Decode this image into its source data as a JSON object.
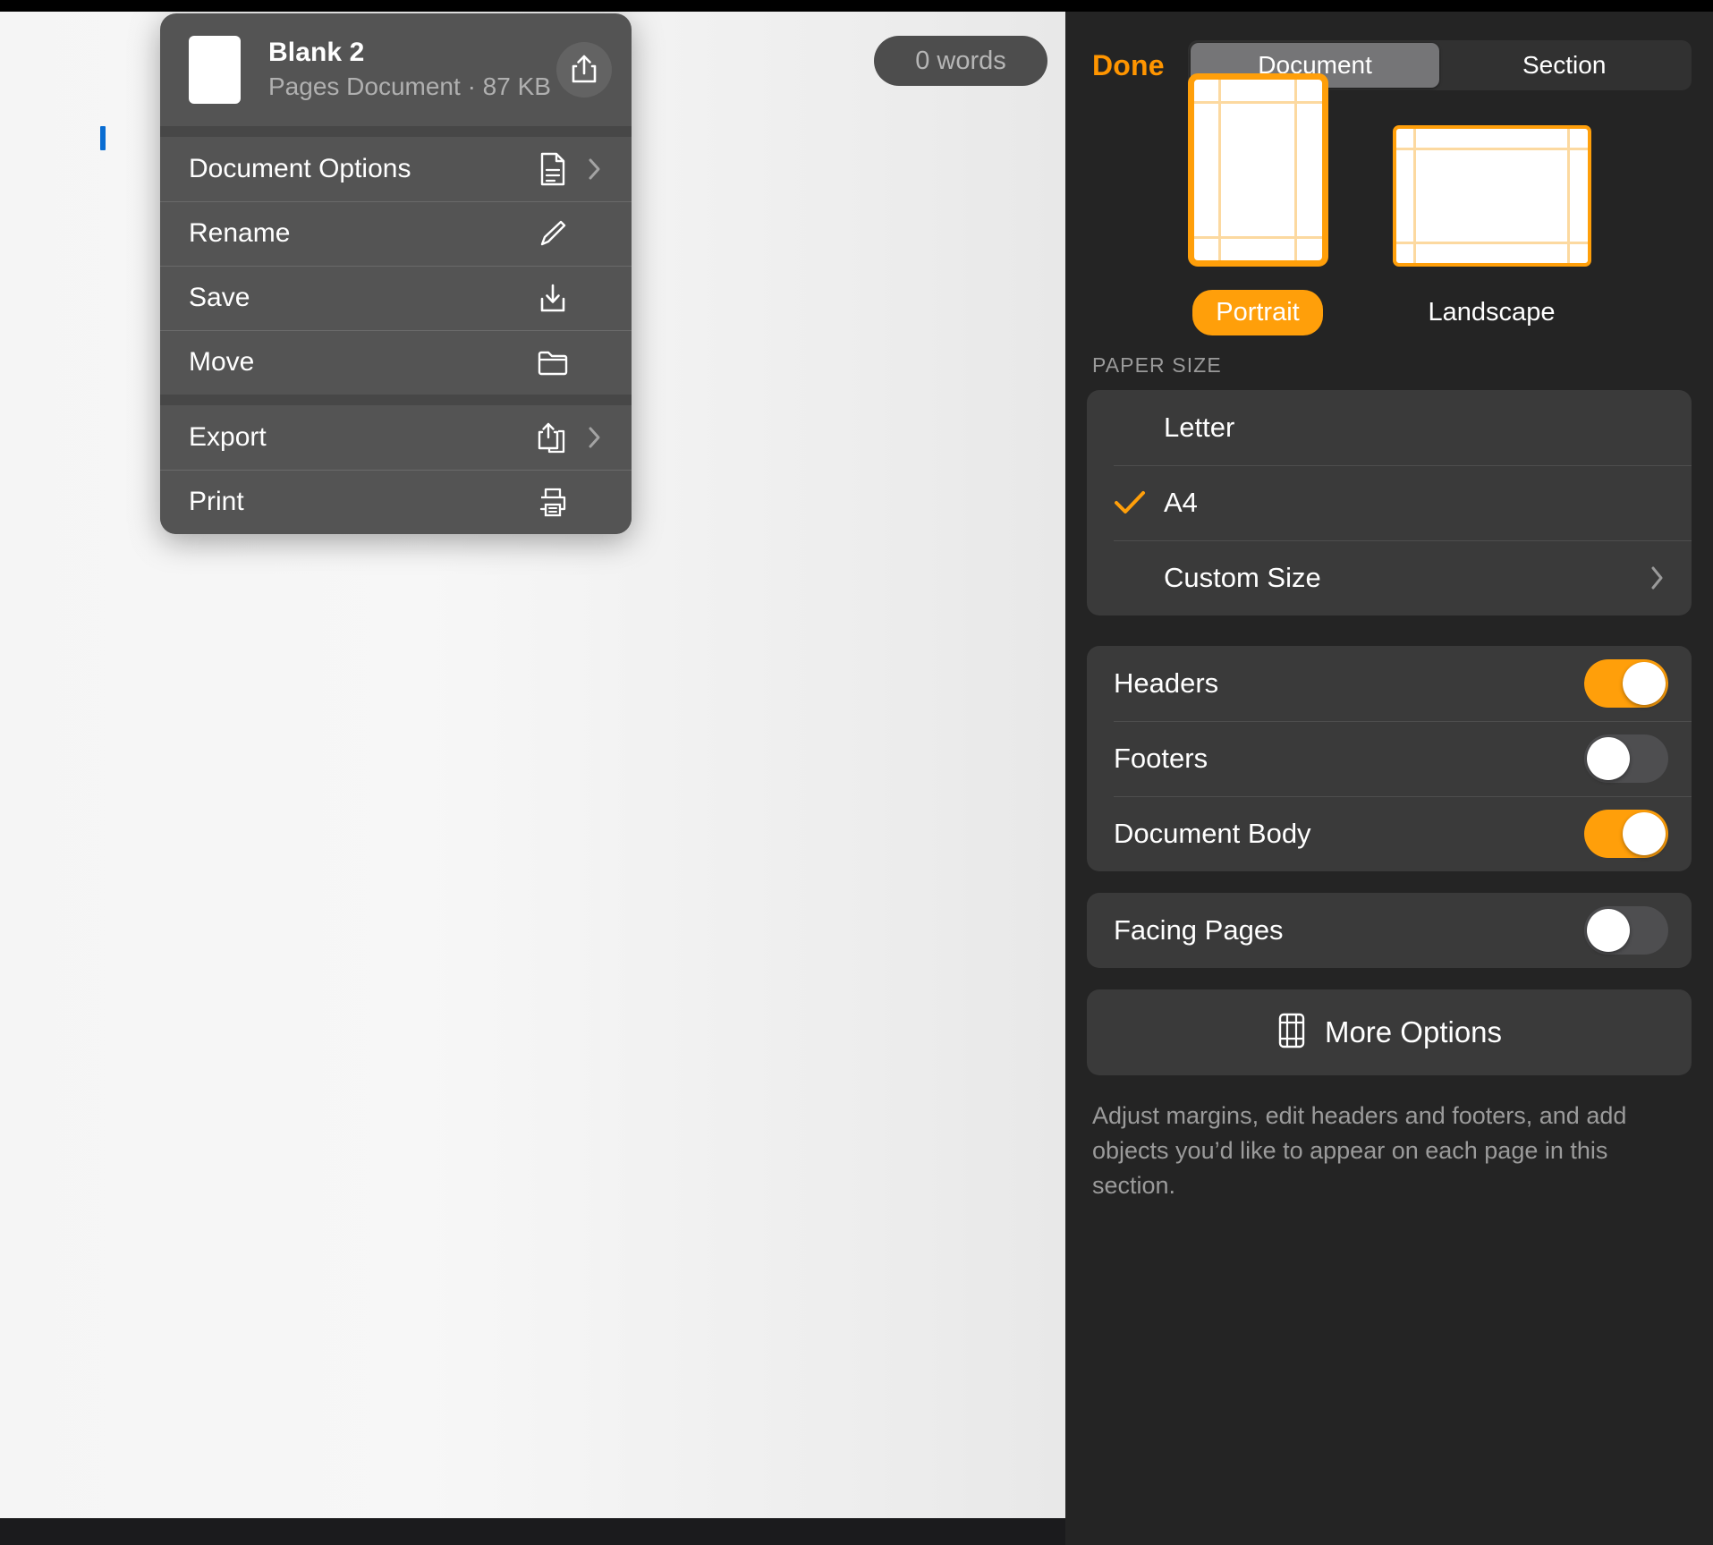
{
  "colors": {
    "accent": "#ff9f0a",
    "done_orange": "#ff9500",
    "panel_bg": "#242424",
    "group_bg": "#3a3a3a",
    "menu_bg": "#545454",
    "cursor_blue": "#0a6dd2",
    "guide": "#fcd9a0"
  },
  "document_canvas": {
    "cursor": "text-cursor",
    "word_count_badge": "0 words"
  },
  "menu": {
    "title": "Blank 2",
    "subtitle": "Pages Document · 87 KB",
    "thumbnail": "document-thumbnail",
    "share_icon": "share-icon",
    "items": [
      {
        "label": "Document Options",
        "icon": "document-icon",
        "chevron": true
      },
      {
        "label": "Rename",
        "icon": "pencil-icon",
        "chevron": false
      },
      {
        "label": "Save",
        "icon": "download-icon",
        "chevron": false
      },
      {
        "label": "Move",
        "icon": "folder-icon",
        "chevron": false
      },
      {
        "label": "Export",
        "icon": "share-stack-icon",
        "chevron": true
      },
      {
        "label": "Print",
        "icon": "printer-icon",
        "chevron": false
      }
    ]
  },
  "inspector": {
    "done_label": "Done",
    "tabs": [
      {
        "label": "Document",
        "active": true
      },
      {
        "label": "Section",
        "active": false
      }
    ],
    "orientation": {
      "options": [
        {
          "label": "Portrait",
          "selected": true
        },
        {
          "label": "Landscape",
          "selected": false
        }
      ]
    },
    "paper_size": {
      "header": "PAPER SIZE",
      "options": [
        {
          "label": "Letter",
          "checked": false,
          "chevron": false
        },
        {
          "label": "A4",
          "checked": true,
          "chevron": false
        },
        {
          "label": "Custom Size",
          "checked": false,
          "chevron": true
        }
      ]
    },
    "toggles_group_1": [
      {
        "label": "Headers",
        "on": true
      },
      {
        "label": "Footers",
        "on": false
      },
      {
        "label": "Document Body",
        "on": true
      }
    ],
    "toggles_group_2": [
      {
        "label": "Facing Pages",
        "on": false
      }
    ],
    "more_options": {
      "label": "More Options",
      "icon": "page-margins-icon"
    },
    "footnote": "Adjust margins, edit headers and footers, and add objects you’d like to appear on each page in this section."
  }
}
